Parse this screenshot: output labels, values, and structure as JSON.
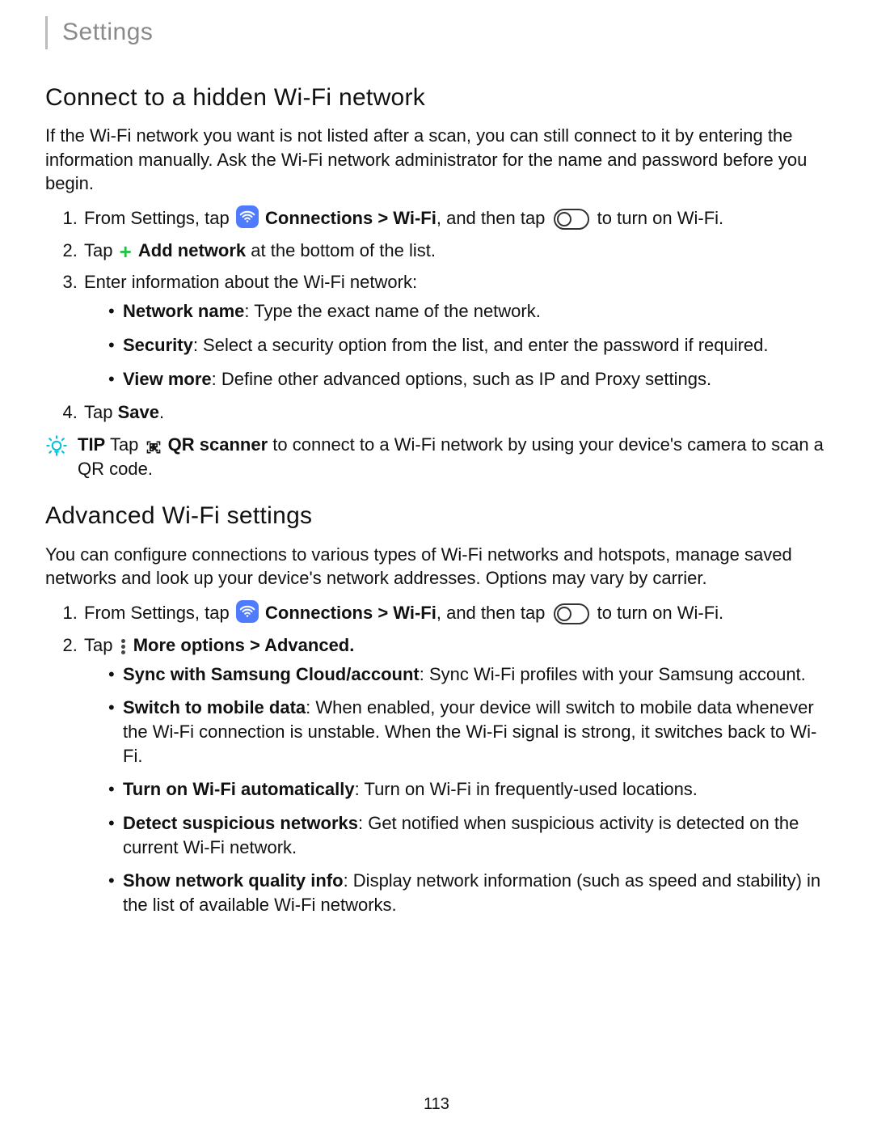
{
  "header": {
    "breadcrumb": "Settings"
  },
  "section1": {
    "title": "Connect to a hidden Wi-Fi network",
    "intro": "If the Wi-Fi network you want is not listed after a scan, you can still connect to it by entering the information manually. Ask the Wi-Fi network administrator for the name and password before you begin.",
    "step1_a": "From Settings, tap",
    "step1_b": "Connections > Wi-Fi",
    "step1_c": ", and then tap",
    "step1_d": "to turn on Wi-Fi.",
    "step2_a": "Tap",
    "step2_b": "Add network",
    "step2_c": " at the bottom of the list.",
    "step3": "Enter information about the Wi-Fi network:",
    "step3_items": [
      {
        "label": "Network name",
        "text": ": Type the exact name of the network."
      },
      {
        "label": "Security",
        "text": ": Select a security option from the list, and enter the password if required."
      },
      {
        "label": "View more",
        "text": ": Define other advanced options, such as IP and Proxy settings."
      }
    ],
    "step4_a": "Tap ",
    "step4_b": "Save",
    "step4_c": ".",
    "tip_label": "TIP",
    "tip_a": " Tap",
    "tip_b": "QR scanner",
    "tip_c": " to connect to a Wi-Fi network by using your device's camera to scan a QR code."
  },
  "section2": {
    "title": "Advanced Wi-Fi settings",
    "intro": "You can configure connections to various types of Wi-Fi networks and hotspots, manage saved networks and look up your device's network addresses. Options may vary by carrier.",
    "step1_a": "From Settings, tap",
    "step1_b": "Connections > Wi-Fi",
    "step1_c": ", and then tap",
    "step1_d": "to turn on Wi-Fi.",
    "step2_a": "Tap",
    "step2_b": "More options > Advanced.",
    "items": [
      {
        "label": "Sync with Samsung Cloud/account",
        "text": ": Sync Wi-Fi profiles with your Samsung account."
      },
      {
        "label": "Switch to mobile data",
        "text": ": When enabled, your device will switch to mobile data whenever the Wi-Fi connection is unstable. When the Wi-Fi signal is strong, it switches back to Wi-Fi."
      },
      {
        "label": "Turn on Wi-Fi automatically",
        "text": ": Turn on Wi-Fi in frequently-used locations."
      },
      {
        "label": "Detect suspicious networks",
        "text": ": Get notified when suspicious activity is detected on the current Wi-Fi network."
      },
      {
        "label": "Show network quality info",
        "text": ": Display network information (such as speed and stability) in the list of available Wi-Fi networks."
      }
    ]
  },
  "page_number": "113"
}
